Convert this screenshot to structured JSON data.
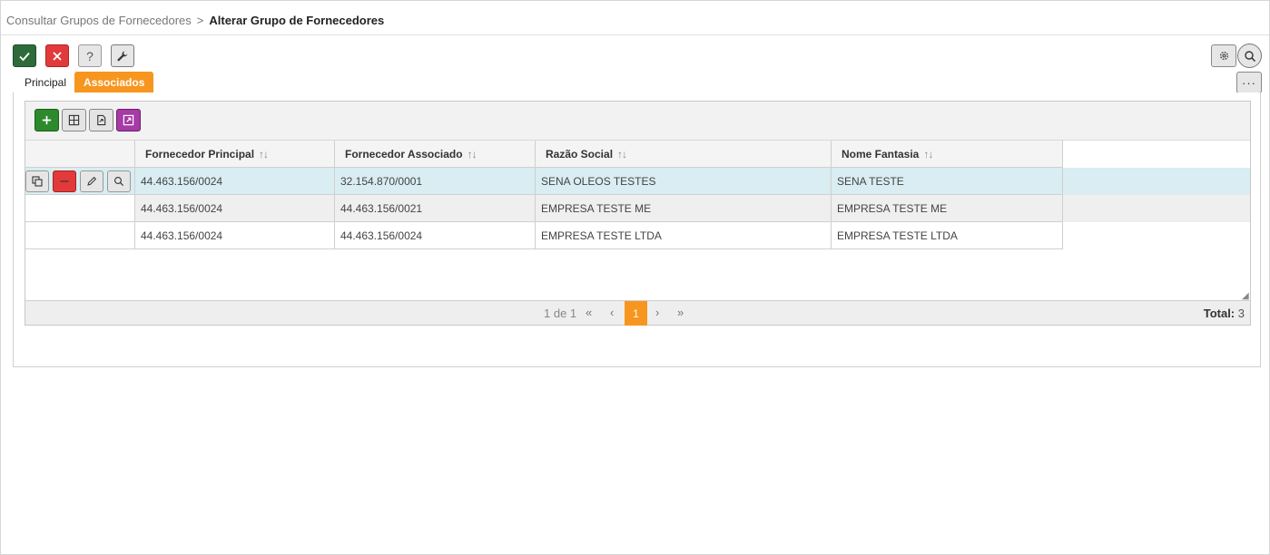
{
  "breadcrumb": {
    "parent": "Consultar Grupos de Fornecedores",
    "separator": ">",
    "current": "Alterar Grupo de Fornecedores"
  },
  "toolbar": {
    "help_label": "?",
    "more_label": "···"
  },
  "tabs": [
    {
      "label": "Principal",
      "active": false
    },
    {
      "label": "Associados",
      "active": true
    }
  ],
  "grid": {
    "columns": [
      {
        "label": "Fornecedor Principal",
        "sort": "↑↓"
      },
      {
        "label": "Fornecedor Associado",
        "sort": "↑↓"
      },
      {
        "label": "Razão Social",
        "sort": "↑↓"
      },
      {
        "label": "Nome Fantasia",
        "sort": "↑↓"
      }
    ],
    "rows": [
      {
        "principal": "44.463.156/0024",
        "associado": "32.154.870/0001",
        "razao": "SENA OLEOS TESTES",
        "fantasia": " SENA TESTE",
        "selected": true
      },
      {
        "principal": "44.463.156/0024",
        "associado": "44.463.156/0021",
        "razao": "EMPRESA TESTE ME",
        "fantasia": "EMPRESA TESTE ME",
        "selected": false
      },
      {
        "principal": "44.463.156/0024",
        "associado": "44.463.156/0024",
        "razao": "EMPRESA TESTE LTDA",
        "fantasia": "EMPRESA TESTE LTDA",
        "selected": false
      }
    ],
    "pager": {
      "info": "1 de 1",
      "first": "«",
      "prev": "‹",
      "current_page": "1",
      "next": "›",
      "last": "»",
      "total_label": "Total:",
      "total_value": "3"
    }
  },
  "colors": {
    "accent_orange": "#f7961e",
    "confirm_green": "#2e6b3b",
    "cancel_red": "#e23a3a",
    "add_green": "#2c8a2c",
    "expand_purple": "#a63aa6",
    "selected_row": "#d9edf2"
  },
  "icons": {
    "confirm": "check-icon",
    "cancel": "close-icon",
    "help": "question-icon",
    "tools": "wrench-icon",
    "settings": "gear-icon",
    "search": "search-icon",
    "add": "plus-icon",
    "columns": "grid-icon",
    "export": "file-export-icon",
    "expand": "expand-icon",
    "copy": "copy-icon",
    "delete": "minus-icon",
    "edit": "pencil-icon",
    "view": "magnifier-icon"
  }
}
